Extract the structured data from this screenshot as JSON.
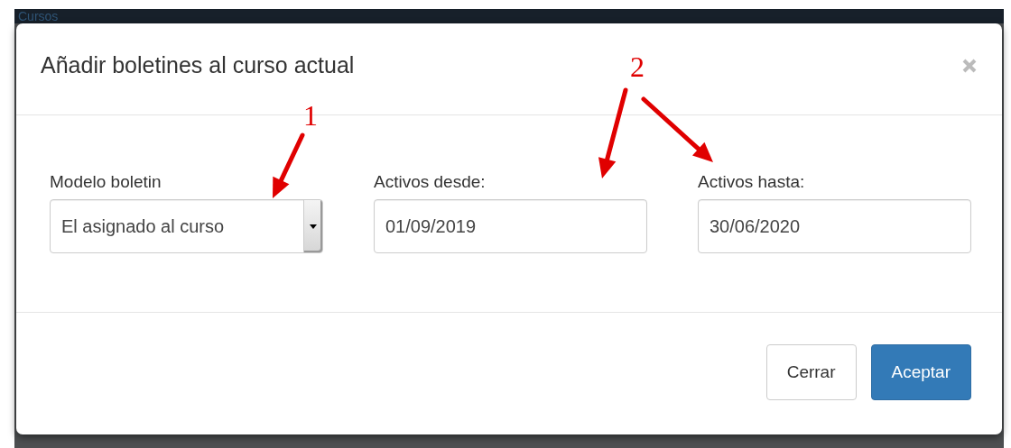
{
  "background": {
    "title": "Cursos"
  },
  "dialog": {
    "title": "Añadir boletines al curso actual",
    "fields": [
      {
        "kind": "select",
        "label": "Modelo boletin",
        "value": "El asignado al curso"
      },
      {
        "kind": "date",
        "label": "Activos desde:",
        "value": "01/09/2019"
      },
      {
        "kind": "date",
        "label": "Activos hasta:",
        "value": "30/06/2020"
      }
    ],
    "buttons": [
      {
        "kind": "default",
        "label": "Cerrar"
      },
      {
        "kind": "primary",
        "label": "Aceptar"
      }
    ]
  },
  "annotations": [
    {
      "label": "1"
    },
    {
      "label": "2"
    }
  ]
}
